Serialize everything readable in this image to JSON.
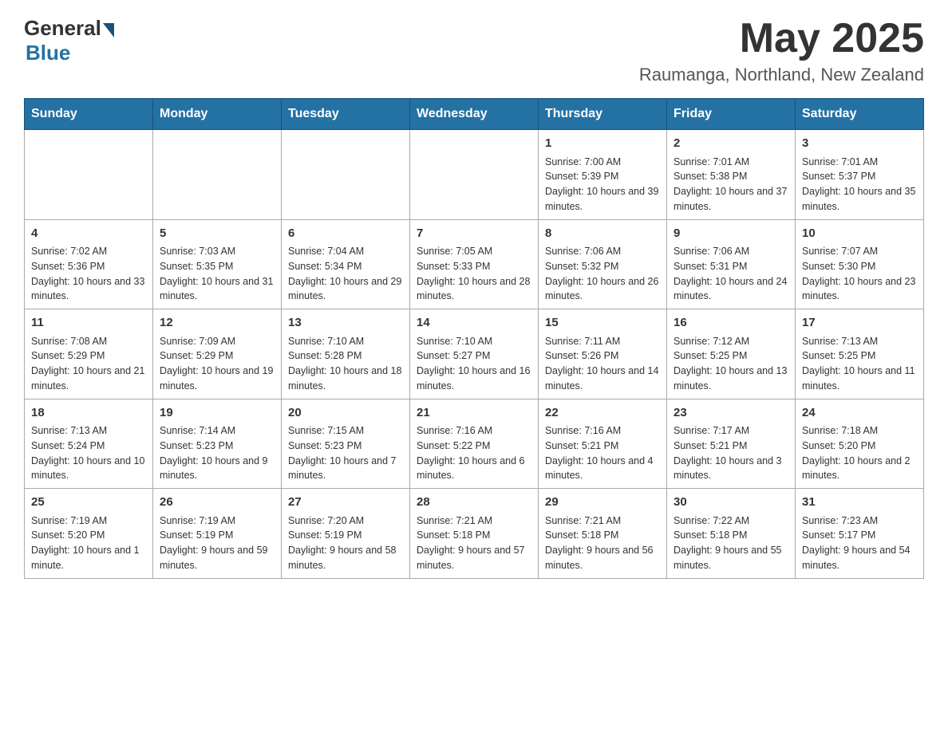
{
  "header": {
    "logo_general": "General",
    "logo_blue": "Blue",
    "month_year": "May 2025",
    "location": "Raumanga, Northland, New Zealand"
  },
  "days_of_week": [
    "Sunday",
    "Monday",
    "Tuesday",
    "Wednesday",
    "Thursday",
    "Friday",
    "Saturday"
  ],
  "weeks": [
    [
      {
        "day": "",
        "info": ""
      },
      {
        "day": "",
        "info": ""
      },
      {
        "day": "",
        "info": ""
      },
      {
        "day": "",
        "info": ""
      },
      {
        "day": "1",
        "info": "Sunrise: 7:00 AM\nSunset: 5:39 PM\nDaylight: 10 hours and 39 minutes."
      },
      {
        "day": "2",
        "info": "Sunrise: 7:01 AM\nSunset: 5:38 PM\nDaylight: 10 hours and 37 minutes."
      },
      {
        "day": "3",
        "info": "Sunrise: 7:01 AM\nSunset: 5:37 PM\nDaylight: 10 hours and 35 minutes."
      }
    ],
    [
      {
        "day": "4",
        "info": "Sunrise: 7:02 AM\nSunset: 5:36 PM\nDaylight: 10 hours and 33 minutes."
      },
      {
        "day": "5",
        "info": "Sunrise: 7:03 AM\nSunset: 5:35 PM\nDaylight: 10 hours and 31 minutes."
      },
      {
        "day": "6",
        "info": "Sunrise: 7:04 AM\nSunset: 5:34 PM\nDaylight: 10 hours and 29 minutes."
      },
      {
        "day": "7",
        "info": "Sunrise: 7:05 AM\nSunset: 5:33 PM\nDaylight: 10 hours and 28 minutes."
      },
      {
        "day": "8",
        "info": "Sunrise: 7:06 AM\nSunset: 5:32 PM\nDaylight: 10 hours and 26 minutes."
      },
      {
        "day": "9",
        "info": "Sunrise: 7:06 AM\nSunset: 5:31 PM\nDaylight: 10 hours and 24 minutes."
      },
      {
        "day": "10",
        "info": "Sunrise: 7:07 AM\nSunset: 5:30 PM\nDaylight: 10 hours and 23 minutes."
      }
    ],
    [
      {
        "day": "11",
        "info": "Sunrise: 7:08 AM\nSunset: 5:29 PM\nDaylight: 10 hours and 21 minutes."
      },
      {
        "day": "12",
        "info": "Sunrise: 7:09 AM\nSunset: 5:29 PM\nDaylight: 10 hours and 19 minutes."
      },
      {
        "day": "13",
        "info": "Sunrise: 7:10 AM\nSunset: 5:28 PM\nDaylight: 10 hours and 18 minutes."
      },
      {
        "day": "14",
        "info": "Sunrise: 7:10 AM\nSunset: 5:27 PM\nDaylight: 10 hours and 16 minutes."
      },
      {
        "day": "15",
        "info": "Sunrise: 7:11 AM\nSunset: 5:26 PM\nDaylight: 10 hours and 14 minutes."
      },
      {
        "day": "16",
        "info": "Sunrise: 7:12 AM\nSunset: 5:25 PM\nDaylight: 10 hours and 13 minutes."
      },
      {
        "day": "17",
        "info": "Sunrise: 7:13 AM\nSunset: 5:25 PM\nDaylight: 10 hours and 11 minutes."
      }
    ],
    [
      {
        "day": "18",
        "info": "Sunrise: 7:13 AM\nSunset: 5:24 PM\nDaylight: 10 hours and 10 minutes."
      },
      {
        "day": "19",
        "info": "Sunrise: 7:14 AM\nSunset: 5:23 PM\nDaylight: 10 hours and 9 minutes."
      },
      {
        "day": "20",
        "info": "Sunrise: 7:15 AM\nSunset: 5:23 PM\nDaylight: 10 hours and 7 minutes."
      },
      {
        "day": "21",
        "info": "Sunrise: 7:16 AM\nSunset: 5:22 PM\nDaylight: 10 hours and 6 minutes."
      },
      {
        "day": "22",
        "info": "Sunrise: 7:16 AM\nSunset: 5:21 PM\nDaylight: 10 hours and 4 minutes."
      },
      {
        "day": "23",
        "info": "Sunrise: 7:17 AM\nSunset: 5:21 PM\nDaylight: 10 hours and 3 minutes."
      },
      {
        "day": "24",
        "info": "Sunrise: 7:18 AM\nSunset: 5:20 PM\nDaylight: 10 hours and 2 minutes."
      }
    ],
    [
      {
        "day": "25",
        "info": "Sunrise: 7:19 AM\nSunset: 5:20 PM\nDaylight: 10 hours and 1 minute."
      },
      {
        "day": "26",
        "info": "Sunrise: 7:19 AM\nSunset: 5:19 PM\nDaylight: 9 hours and 59 minutes."
      },
      {
        "day": "27",
        "info": "Sunrise: 7:20 AM\nSunset: 5:19 PM\nDaylight: 9 hours and 58 minutes."
      },
      {
        "day": "28",
        "info": "Sunrise: 7:21 AM\nSunset: 5:18 PM\nDaylight: 9 hours and 57 minutes."
      },
      {
        "day": "29",
        "info": "Sunrise: 7:21 AM\nSunset: 5:18 PM\nDaylight: 9 hours and 56 minutes."
      },
      {
        "day": "30",
        "info": "Sunrise: 7:22 AM\nSunset: 5:18 PM\nDaylight: 9 hours and 55 minutes."
      },
      {
        "day": "31",
        "info": "Sunrise: 7:23 AM\nSunset: 5:17 PM\nDaylight: 9 hours and 54 minutes."
      }
    ]
  ]
}
